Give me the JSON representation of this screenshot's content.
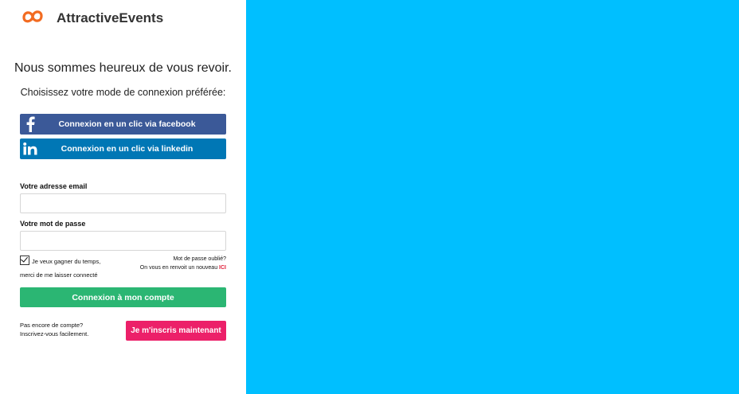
{
  "brand": {
    "name": "AttractiveEvents",
    "logo_icon": "infinity-logo-icon",
    "logo_color": "#f26b21"
  },
  "welcome": "Nous sommes heureux de vous revoir.",
  "choose_mode": "Choisissez votre mode de connexion préférée:",
  "social": {
    "facebook": {
      "label": "Connexion en un clic via facebook",
      "icon": "facebook-icon",
      "color": "#3b5998"
    },
    "linkedin": {
      "label": "Connexion en un clic via linkedin",
      "icon": "linkedin-icon",
      "color": "#0077b5"
    }
  },
  "form": {
    "email_label": "Votre adresse email",
    "email_value": "",
    "password_label": "Votre mot de passe",
    "password_value": "",
    "remember_line1": "Je veux gagner du temps,",
    "remember_line2": "merci de me laisser connecté",
    "remember_checked": true,
    "forgot_line1": "Mot de passe oublié?",
    "forgot_line2": "On vous en renvoit un nouveau",
    "forgot_link": "ICI",
    "submit_label": "Connexion à mon compte",
    "submit_color": "#2bb673"
  },
  "signup": {
    "prompt_line1": "Pas encore de compte?",
    "prompt_line2": "Inscrivez-vous facilement.",
    "button_label": "Je m'inscris maintenant",
    "button_color": "#ec2069"
  },
  "right_panel_color": "#00bfff"
}
